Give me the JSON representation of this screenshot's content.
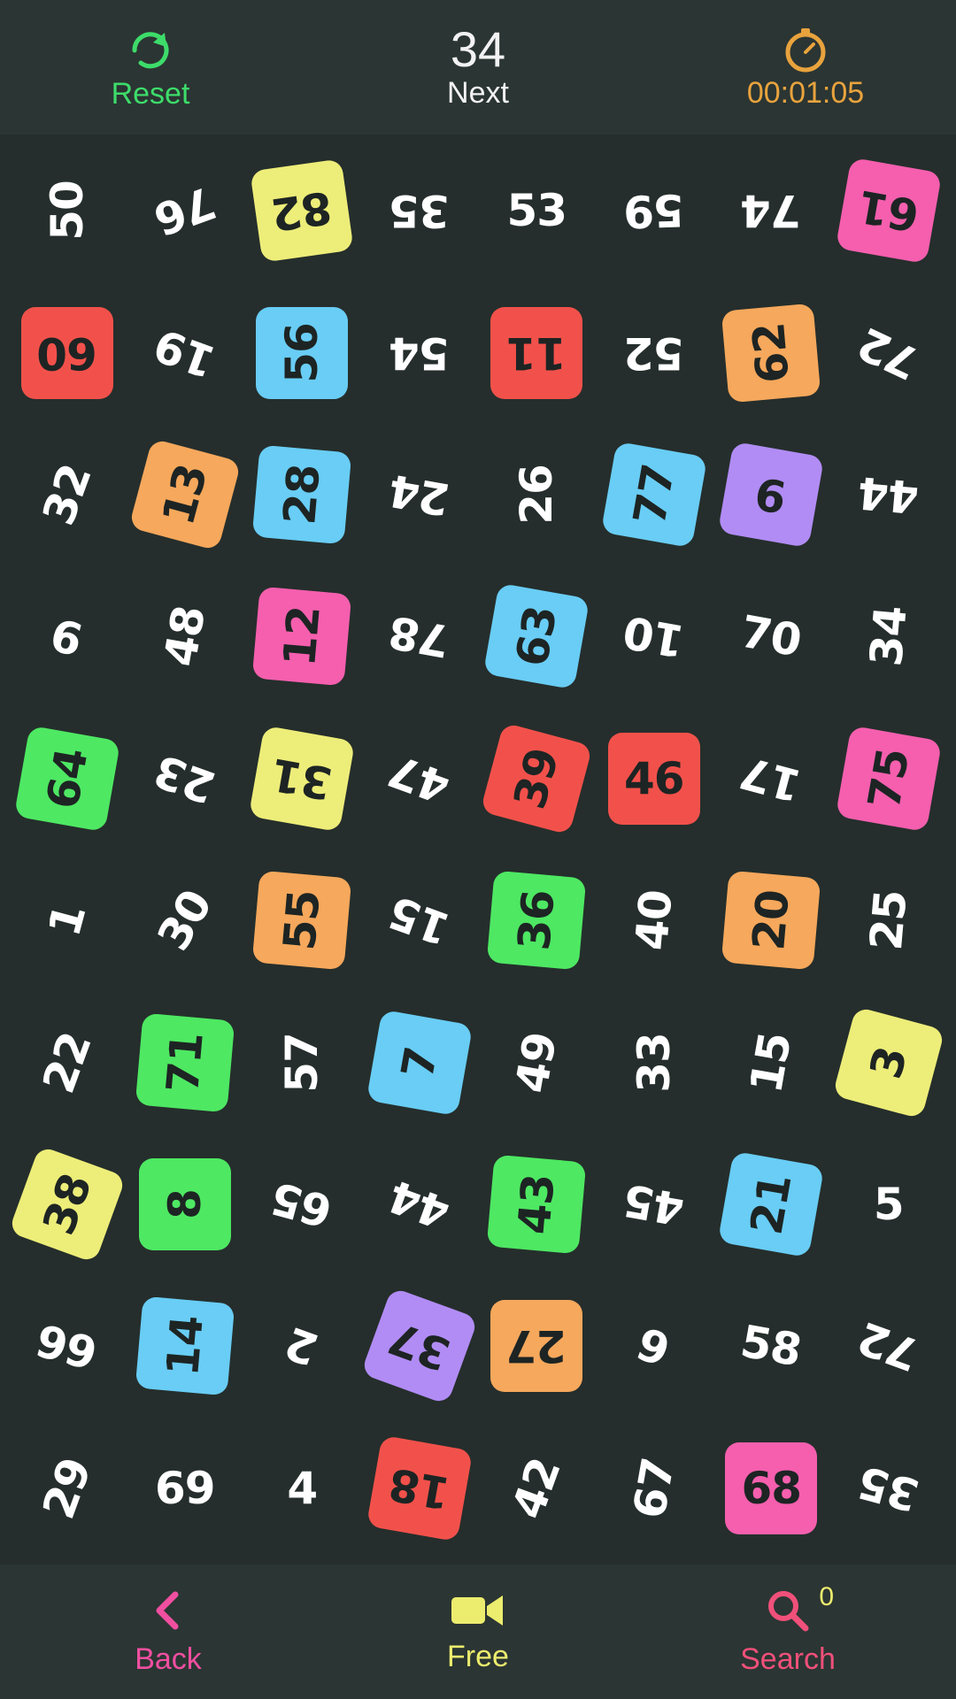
{
  "topbar": {
    "reset_label": "Reset",
    "reset_icon": "refresh-icon",
    "next_number": "34",
    "next_label": "Next",
    "timer_icon": "stopwatch-icon",
    "timer_value": "00:01:05",
    "reset_color": "#3ddc6a",
    "timer_color": "#e8a33d"
  },
  "bottombar": {
    "back_label": "Back",
    "back_icon": "chevron-left-icon",
    "free_label": "Free",
    "free_icon": "video-camera-icon",
    "search_label": "Search",
    "search_icon": "magnifier-icon",
    "search_count": "0",
    "back_color": "#f04fa0",
    "free_color": "#ecec6e",
    "search_color": "#f0507a"
  },
  "palette": {
    "background": "#252e2c",
    "bar": "#2b3533",
    "plain_text": "#ffffff",
    "chip_text": "#1d2423",
    "pink": "#f55fae",
    "red": "#f2514b",
    "orange": "#f6a85c",
    "yellow": "#eded79",
    "green": "#4ee863",
    "blue": "#69cdf5",
    "purple": "#b18cf5"
  },
  "grid": {
    "columns": 8,
    "rows": 10,
    "tiles": [
      {
        "value": "50",
        "style": "plain",
        "rot": -90
      },
      {
        "value": "76",
        "style": "plain",
        "rot": 160
      },
      {
        "value": "82",
        "style": "chip",
        "color": "yellow",
        "rot": 172
      },
      {
        "value": "35",
        "style": "plain",
        "rot": 180
      },
      {
        "value": "53",
        "style": "plain",
        "rot": 0
      },
      {
        "value": "59",
        "style": "plain",
        "rot": 178
      },
      {
        "value": "74",
        "style": "plain",
        "rot": 180
      },
      {
        "value": "61",
        "style": "chip",
        "color": "pink",
        "rot": 190
      },
      {
        "value": "60",
        "style": "chip",
        "color": "red",
        "rot": 180
      },
      {
        "value": "19",
        "style": "plain",
        "rot": 200
      },
      {
        "value": "56",
        "style": "chip",
        "color": "blue",
        "rot": 270
      },
      {
        "value": "54",
        "style": "plain",
        "rot": 180
      },
      {
        "value": "11",
        "style": "chip",
        "color": "red",
        "rot": 180
      },
      {
        "value": "52",
        "style": "plain",
        "rot": 180
      },
      {
        "value": "62",
        "style": "chip",
        "color": "orange",
        "rot": 265
      },
      {
        "value": "72",
        "style": "plain",
        "rot": 205
      },
      {
        "value": "32",
        "style": "plain",
        "rot": 290
      },
      {
        "value": "13",
        "style": "chip",
        "color": "orange",
        "rot": 285
      },
      {
        "value": "28",
        "style": "chip",
        "color": "blue",
        "rot": 275
      },
      {
        "value": "24",
        "style": "plain",
        "rot": 190
      },
      {
        "value": "26",
        "style": "plain",
        "rot": 270
      },
      {
        "value": "77",
        "style": "chip",
        "color": "blue",
        "rot": 280
      },
      {
        "value": "9",
        "style": "chip",
        "color": "purple",
        "rot": 190
      },
      {
        "value": "44",
        "style": "plain",
        "rot": 185
      },
      {
        "value": "9",
        "style": "plain",
        "rot": 195
      },
      {
        "value": "48",
        "style": "plain",
        "rot": 280
      },
      {
        "value": "12",
        "style": "chip",
        "color": "pink",
        "rot": 275
      },
      {
        "value": "78",
        "style": "plain",
        "rot": 190
      },
      {
        "value": "63",
        "style": "chip",
        "color": "blue",
        "rot": 280
      },
      {
        "value": "10",
        "style": "plain",
        "rot": 190
      },
      {
        "value": "70",
        "style": "plain",
        "rot": 10
      },
      {
        "value": "34",
        "style": "plain",
        "rot": 275
      },
      {
        "value": "64",
        "style": "chip",
        "color": "green",
        "rot": 280
      },
      {
        "value": "23",
        "style": "plain",
        "rot": 200
      },
      {
        "value": "31",
        "style": "chip",
        "color": "yellow",
        "rot": 190
      },
      {
        "value": "47",
        "style": "plain",
        "rot": 200
      },
      {
        "value": "39",
        "style": "chip",
        "color": "red",
        "rot": 285
      },
      {
        "value": "46",
        "style": "chip",
        "color": "red",
        "rot": 0
      },
      {
        "value": "17",
        "style": "plain",
        "rot": 195
      },
      {
        "value": "75",
        "style": "chip",
        "color": "pink",
        "rot": 280
      },
      {
        "value": "1",
        "style": "plain",
        "rot": 285
      },
      {
        "value": "30",
        "style": "plain",
        "rot": 300
      },
      {
        "value": "55",
        "style": "chip",
        "color": "orange",
        "rot": 275
      },
      {
        "value": "15",
        "style": "plain",
        "rot": 200
      },
      {
        "value": "36",
        "style": "chip",
        "color": "green",
        "rot": 275
      },
      {
        "value": "40",
        "style": "plain",
        "rot": 275
      },
      {
        "value": "20",
        "style": "chip",
        "color": "orange",
        "rot": 275
      },
      {
        "value": "25",
        "style": "plain",
        "rot": 275
      },
      {
        "value": "22",
        "style": "plain",
        "rot": 290
      },
      {
        "value": "71",
        "style": "chip",
        "color": "green",
        "rot": 275
      },
      {
        "value": "57",
        "style": "plain",
        "rot": 270
      },
      {
        "value": "7",
        "style": "chip",
        "color": "blue",
        "rot": 280
      },
      {
        "value": "49",
        "style": "plain",
        "rot": 280
      },
      {
        "value": "33",
        "style": "plain",
        "rot": 270
      },
      {
        "value": "15",
        "style": "plain",
        "rot": 280
      },
      {
        "value": "3",
        "style": "chip",
        "color": "yellow",
        "rot": 285
      },
      {
        "value": "38",
        "style": "chip",
        "color": "yellow",
        "rot": 290
      },
      {
        "value": "8",
        "style": "chip",
        "color": "green",
        "rot": 270
      },
      {
        "value": "65",
        "style": "plain",
        "rot": 195
      },
      {
        "value": "44",
        "style": "plain",
        "rot": 200
      },
      {
        "value": "43",
        "style": "chip",
        "color": "green",
        "rot": 275
      },
      {
        "value": "45",
        "style": "plain",
        "rot": 190
      },
      {
        "value": "21",
        "style": "chip",
        "color": "blue",
        "rot": 280
      },
      {
        "value": "5",
        "style": "plain",
        "rot": 0
      },
      {
        "value": "66",
        "style": "plain",
        "rot": 195
      },
      {
        "value": "14",
        "style": "chip",
        "color": "blue",
        "rot": 275
      },
      {
        "value": "2",
        "style": "plain",
        "rot": 200
      },
      {
        "value": "37",
        "style": "chip",
        "color": "purple",
        "rot": 200
      },
      {
        "value": "27",
        "style": "chip",
        "color": "orange",
        "rot": 180
      },
      {
        "value": "6",
        "style": "plain",
        "rot": 200
      },
      {
        "value": "58",
        "style": "plain",
        "rot": 10
      },
      {
        "value": "72",
        "style": "plain",
        "rot": 200
      },
      {
        "value": "29",
        "style": "plain",
        "rot": 290
      },
      {
        "value": "69",
        "style": "plain",
        "rot": 0
      },
      {
        "value": "4",
        "style": "plain",
        "rot": 0
      },
      {
        "value": "18",
        "style": "chip",
        "color": "red",
        "rot": 190
      },
      {
        "value": "42",
        "style": "plain",
        "rot": 290
      },
      {
        "value": "67",
        "style": "plain",
        "rot": 280
      },
      {
        "value": "68",
        "style": "chip",
        "color": "pink",
        "rot": 0
      },
      {
        "value": "35",
        "style": "plain",
        "rot": 195
      }
    ]
  }
}
